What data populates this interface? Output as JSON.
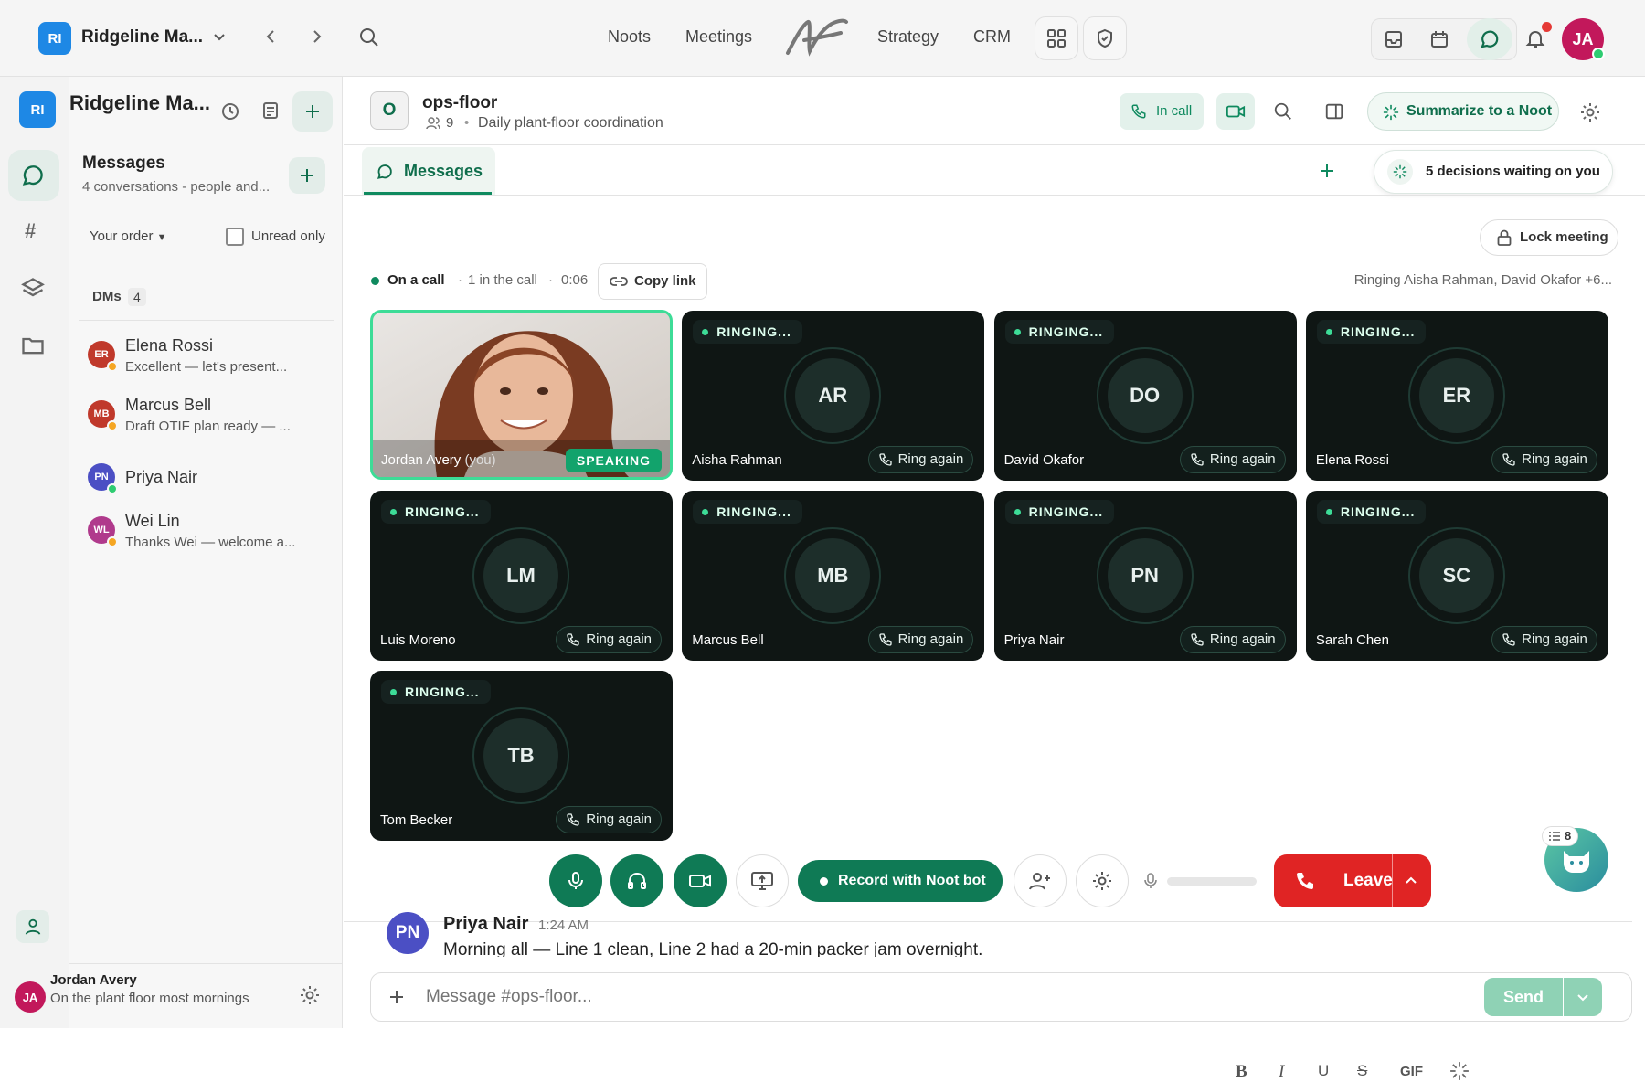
{
  "workspace": {
    "initials": "RI",
    "name": "Ridgeline Ma..."
  },
  "topnav": {
    "items": [
      "Noots",
      "Meetings",
      "Strategy",
      "CRM"
    ]
  },
  "user": {
    "initials": "JA",
    "name": "Jordan Avery",
    "status": "On the plant floor most mornings"
  },
  "sidebar": {
    "title": "Messages",
    "subtitle": "4 conversations - people and...",
    "sort_label": "Your order",
    "unread_label": "Unread only",
    "dms_label": "DMs",
    "dms_count": "4",
    "dms": [
      {
        "initials": "ER",
        "name": "Elena Rossi",
        "preview": "Excellent — let's present...",
        "color": "#c0392b",
        "status": "#f5a623"
      },
      {
        "initials": "MB",
        "name": "Marcus Bell",
        "preview": "Draft OTIF plan ready — ...",
        "color": "#c0392b",
        "status": "#f5a623"
      },
      {
        "initials": "PN",
        "name": "Priya Nair",
        "preview": "",
        "color": "#4b4fc4",
        "status": "#2ecc71"
      },
      {
        "initials": "WL",
        "name": "Wei Lin",
        "preview": "Thanks Wei — welcome a...",
        "color": "#b03a8c",
        "status": "#f5a623"
      }
    ]
  },
  "channel": {
    "initial": "O",
    "name": "ops-floor",
    "members": "9",
    "description": "Daily plant-floor coordination",
    "in_call_label": "In call",
    "summarize_label": "Summarize to a Noot",
    "tab_label": "Messages",
    "decisions_label": "5 decisions waiting on you"
  },
  "call": {
    "status": "On a call",
    "in_call": "1 in the call",
    "timer": "0:06",
    "copy_link_label": "Copy link",
    "lock_label": "Lock meeting",
    "ringing_text": "Ringing Aisha Rahman, David Okafor +6...",
    "self_name": "Jordan Avery",
    "self_suffix": "(you)",
    "speaking_label": "SPEAKING",
    "ringing_label": "RINGING...",
    "ring_again_label": "Ring again",
    "participants": [
      {
        "initials": "AR",
        "name": "Aisha Rahman"
      },
      {
        "initials": "DO",
        "name": "David Okafor"
      },
      {
        "initials": "ER",
        "name": "Elena Rossi"
      },
      {
        "initials": "LM",
        "name": "Luis Moreno"
      },
      {
        "initials": "MB",
        "name": "Marcus Bell"
      },
      {
        "initials": "PN",
        "name": "Priya Nair"
      },
      {
        "initials": "SC",
        "name": "Sarah Chen"
      },
      {
        "initials": "TB",
        "name": "Tom Becker"
      }
    ],
    "record_label": "Record with Noot bot",
    "leave_label": "Leave",
    "bot_badge": "8"
  },
  "message": {
    "initials": "PN",
    "author": "Priya Nair",
    "time": "1:24 AM",
    "text": "Morning all — Line 1 clean, Line 2 had a 20-min packer jam overnight."
  },
  "composer": {
    "placeholder": "Message #ops-floor...",
    "gif_label": "GIF",
    "send_label": "Send"
  },
  "colors": {
    "accent": "#0f8a5f",
    "leave": "#e02424",
    "workspace": "#1e88e5",
    "avatar": "#c2185b"
  }
}
